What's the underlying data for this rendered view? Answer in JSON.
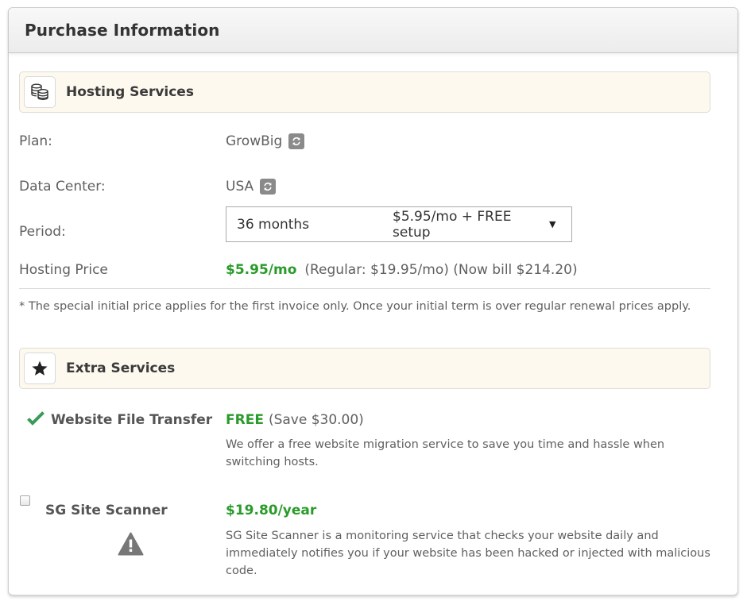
{
  "panel": {
    "title": "Purchase Information"
  },
  "hosting": {
    "section_title": "Hosting Services",
    "section_icon": "coins-icon",
    "plan": {
      "label": "Plan:",
      "value": "GrowBig",
      "change_icon": "refresh-icon"
    },
    "data_center": {
      "label": "Data Center:",
      "value": "USA",
      "change_icon": "refresh-icon"
    },
    "period": {
      "label": "Period:",
      "selected_months": "36 months",
      "selected_price": "$5.95/mo + FREE setup",
      "caret": "▼"
    },
    "price": {
      "label": "Hosting Price",
      "amount": "$5.95/mo",
      "details": "(Regular: $19.95/mo) (Now bill $214.20)"
    },
    "note": "* The special initial price applies for the first invoice only. Once your initial term is over regular renewal prices apply."
  },
  "extras": {
    "section_title": "Extra Services",
    "section_icon": "star-icon",
    "items": [
      {
        "name": "Website File Transfer",
        "status_icon": "checkmark-icon",
        "checked": true,
        "price": "FREE",
        "price_note": "(Save $30.00)",
        "description": "We offer a free website migration service to save you time and hassle when switching hosts."
      },
      {
        "name": "SG Site Scanner",
        "status_icon": "warning-icon",
        "checked": false,
        "price": "$19.80/year",
        "description": "SG Site Scanner is a monitoring service that checks your website daily and immediately notifies you if your website has been hacked or injected with malicious code."
      }
    ]
  },
  "colors": {
    "accent_green": "#2a9b2a",
    "section_bg": "#fdf9ee",
    "check_green": "#3a9a5a"
  }
}
